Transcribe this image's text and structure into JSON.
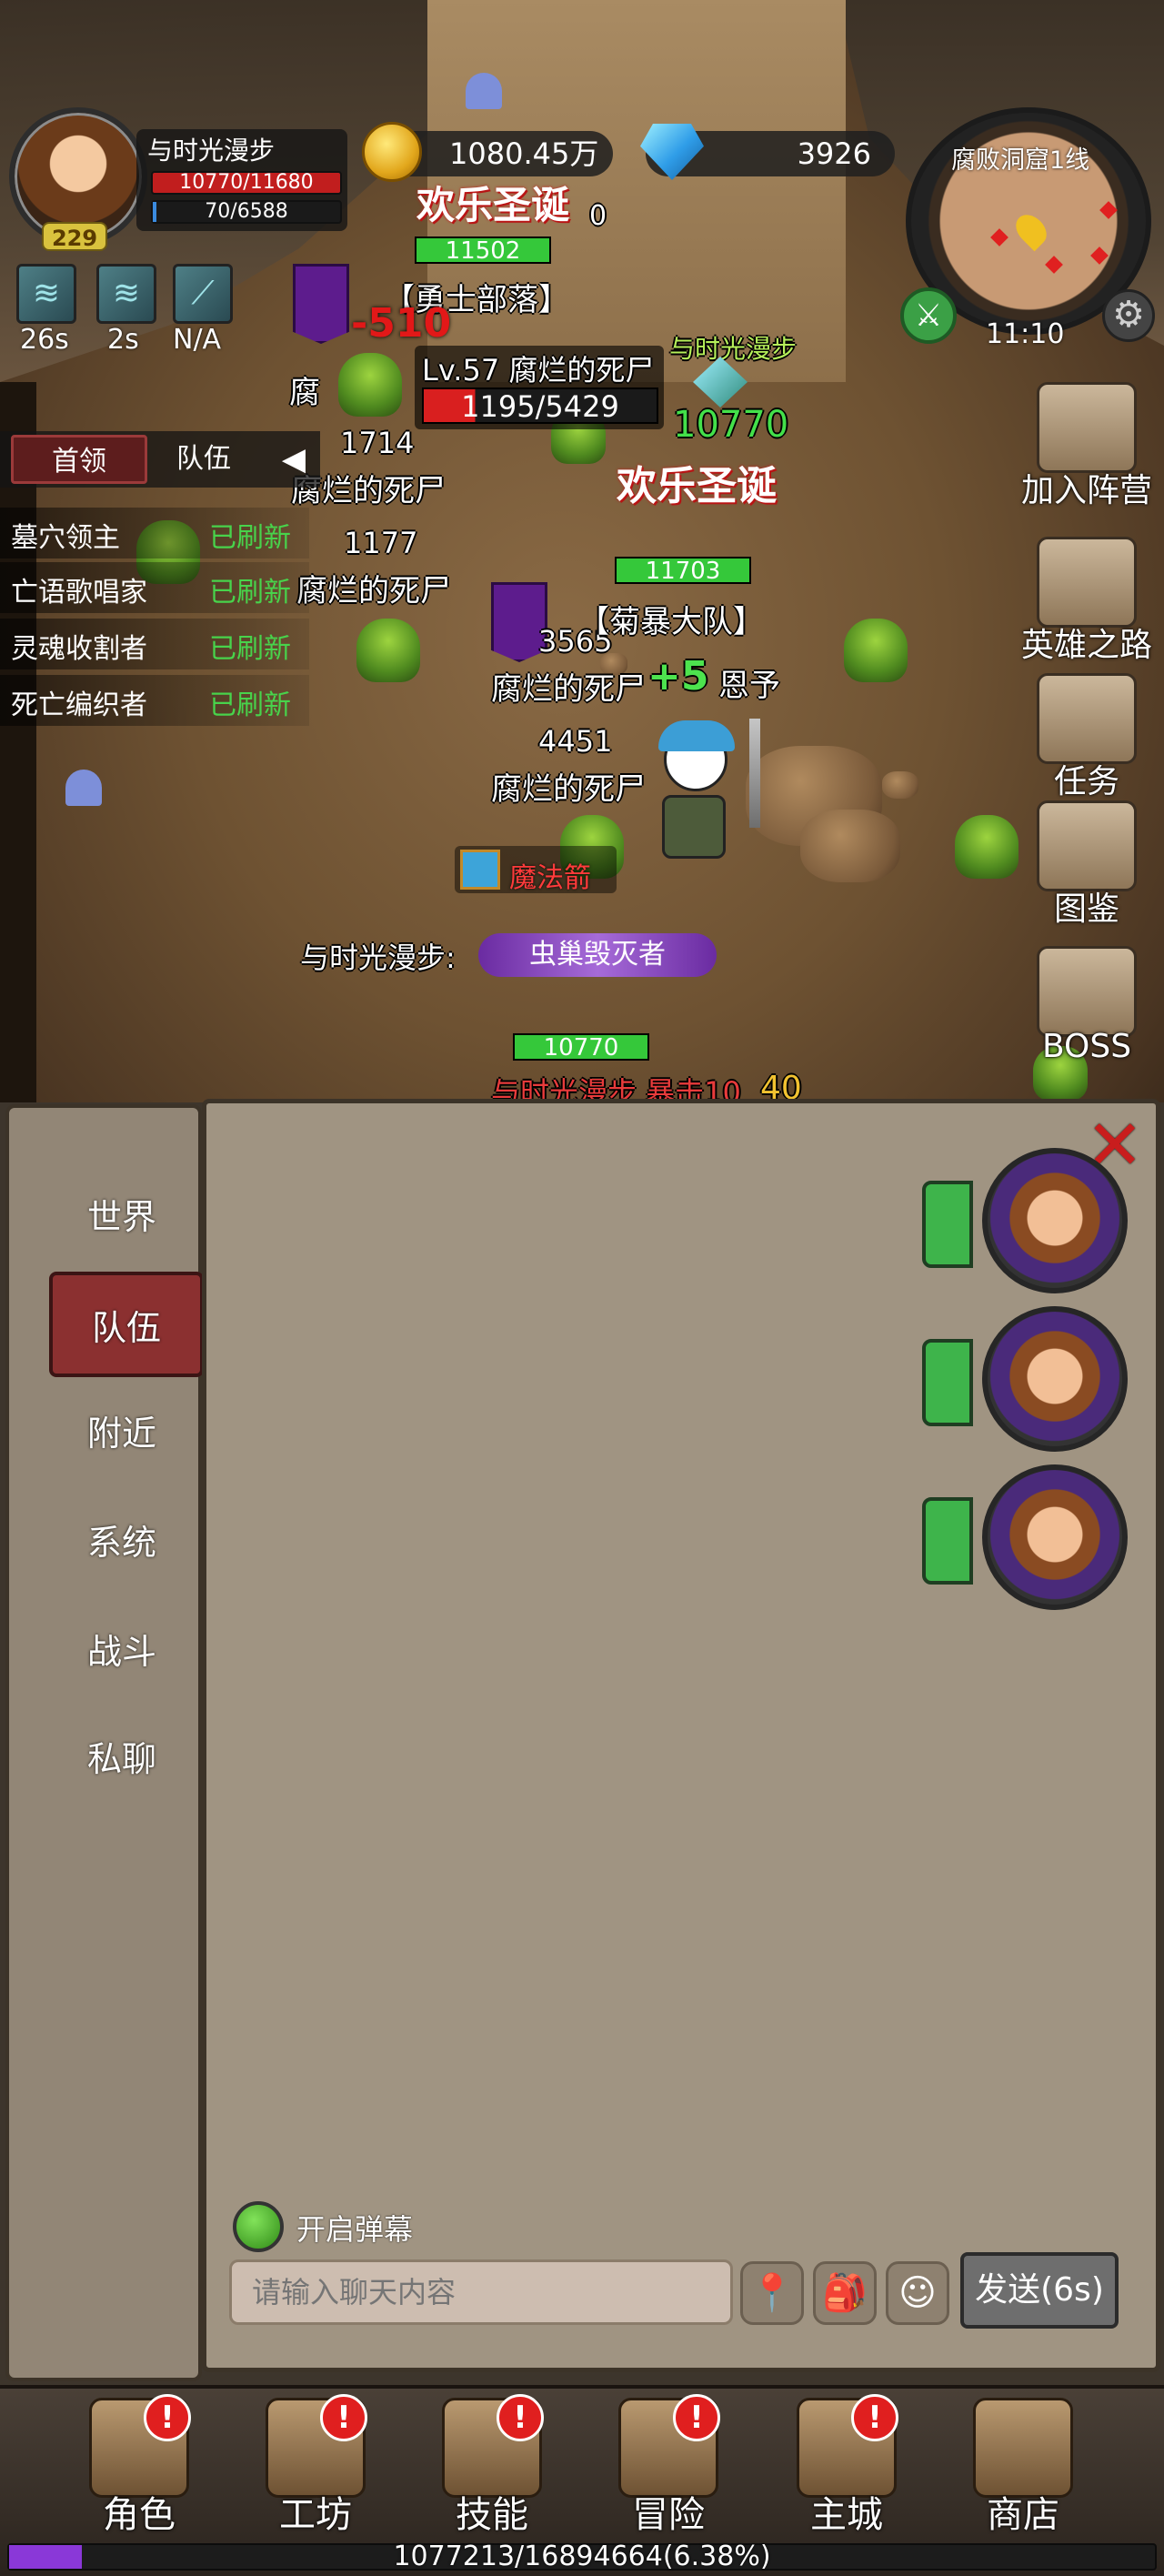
{
  "player": {
    "name": "与时光漫步",
    "level": "229",
    "hp": "10770/11680",
    "mp": "70/6588"
  },
  "resources": {
    "gold": "1080.45万",
    "gems": "3926"
  },
  "minimap": {
    "location": "腐败洞窟1线",
    "time": "11:10"
  },
  "skills": [
    {
      "cooldown": "26s"
    },
    {
      "cooldown": "2s"
    },
    {
      "cooldown": "N/A"
    }
  ],
  "boss_panel": {
    "tab_leader": "首领",
    "tab_team": "队伍",
    "arrow": "◀",
    "rows": [
      {
        "name": "墓穴领主",
        "status": "已刷新"
      },
      {
        "name": "亡语歌唱家",
        "status": "已刷新"
      },
      {
        "name": "灵魂收割者",
        "status": "已刷新"
      },
      {
        "name": "死亡编织者",
        "status": "已刷新"
      }
    ]
  },
  "side_menu": [
    {
      "label": "加入阵营"
    },
    {
      "label": "英雄之路"
    },
    {
      "label": "任务"
    },
    {
      "label": "图鉴"
    },
    {
      "label": "BOSS"
    }
  ],
  "field": {
    "ally_hp_top": "11502",
    "guild_tag": "【勇士部落】",
    "xmas_text": "欢乐圣诞",
    "xmas_count": "0",
    "target_name": "Lv.57 腐烂的死尸",
    "target_hp": "1195/5429",
    "dmg_top": "-510",
    "mob_hp_1": "1714",
    "mob_name": "腐烂的死尸",
    "mob_hp_2": "1177",
    "mob_hp_3": "3565",
    "mob_hp_4": "4451",
    "ally_name": "与时光漫步",
    "ally_hp_right": "10770",
    "ally_hp_mid": "11703",
    "team_tag": "【菊暴大队】",
    "heal_text": "+5",
    "blessing": "恩予",
    "fragment": "腐",
    "magic_arrow": "魔法箭",
    "player_label": "与时光漫步:",
    "player_title": "虫巢毁灭者",
    "player_hp": "10770",
    "crit_text": "与时光漫步 暴击10",
    "crit_num": "40"
  },
  "chat": {
    "channels": [
      "世界",
      "队伍",
      "附近",
      "系统",
      "战斗",
      "私聊"
    ],
    "active_channel": "队伍",
    "close": "✕",
    "danmu_label": "开启弹幕",
    "input_placeholder": "请输入聊天内容",
    "send_label": "发送(6s)"
  },
  "nav": {
    "items": [
      {
        "label": "角色",
        "badge": "!"
      },
      {
        "label": "工坊",
        "badge": "!"
      },
      {
        "label": "技能",
        "badge": "!"
      },
      {
        "label": "冒险",
        "badge": "!"
      },
      {
        "label": "主城",
        "badge": "!"
      },
      {
        "label": "商店",
        "badge": ""
      }
    ],
    "xp_text": "1077213/16894664(6.38%)",
    "xp_fraction": 0.0638
  },
  "colors": {
    "accent_red": "#c91d1d",
    "hp_green": "#35c83a",
    "status_green": "#48d34b",
    "xp_purple": "#8a38d8"
  }
}
